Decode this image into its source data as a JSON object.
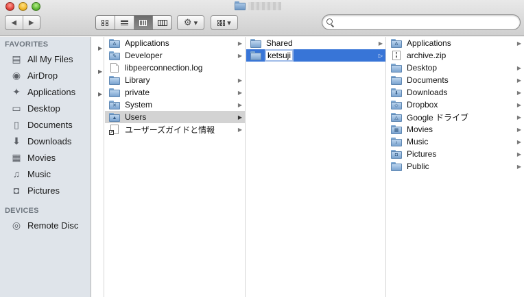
{
  "toolbar": {
    "back_glyph": "◀",
    "forward_glyph": "▶",
    "action_glyph": "⚙",
    "dropdown_glyph": "▾",
    "search_placeholder": ""
  },
  "sidebar": {
    "favorites_heading": "FAVORITES",
    "favorites": [
      {
        "label": "All My Files",
        "icon": "all-files-icon",
        "glyph": "▤"
      },
      {
        "label": "AirDrop",
        "icon": "airdrop-icon",
        "glyph": "◉"
      },
      {
        "label": "Applications",
        "icon": "applications-icon",
        "glyph": "✦"
      },
      {
        "label": "Desktop",
        "icon": "desktop-icon",
        "glyph": "▭"
      },
      {
        "label": "Documents",
        "icon": "documents-icon",
        "glyph": "▯"
      },
      {
        "label": "Downloads",
        "icon": "downloads-icon",
        "glyph": "⬇"
      },
      {
        "label": "Movies",
        "icon": "movies-icon",
        "glyph": "▦"
      },
      {
        "label": "Music",
        "icon": "music-icon",
        "glyph": "♫"
      },
      {
        "label": "Pictures",
        "icon": "pictures-icon",
        "glyph": "◘"
      }
    ],
    "devices_heading": "DEVICES",
    "devices": [
      {
        "label": "Remote Disc",
        "icon": "remote-disc-icon",
        "glyph": "◎"
      }
    ]
  },
  "column1": {
    "disclosures": [
      "▶",
      "▶",
      "▶"
    ]
  },
  "column2": {
    "items": [
      {
        "label": "Applications",
        "kind": "folder",
        "glyph": "A",
        "chev": "▶"
      },
      {
        "label": "Developer",
        "kind": "folder",
        "glyph": "✎",
        "chev": "▶"
      },
      {
        "label": "libpeerconnection.log",
        "kind": "doc",
        "glyph": "",
        "chev": ""
      },
      {
        "label": "Library",
        "kind": "folder",
        "glyph": "",
        "chev": "▶"
      },
      {
        "label": "private",
        "kind": "folder",
        "glyph": "",
        "chev": "▶"
      },
      {
        "label": "System",
        "kind": "folder",
        "glyph": "✕",
        "chev": "▶"
      },
      {
        "label": "Users",
        "kind": "folder",
        "glyph": "▲",
        "chev": "▶",
        "state": "grey"
      },
      {
        "label": "ユーザーズガイドと情報",
        "kind": "alias",
        "glyph": "",
        "chev": "▶"
      }
    ]
  },
  "column3": {
    "items": [
      {
        "label": "Shared",
        "kind": "folder",
        "glyph": "",
        "chev": "▶"
      },
      {
        "label": "ketsuji",
        "kind": "folder",
        "glyph": "",
        "chev": "▷",
        "state": "blue"
      }
    ]
  },
  "column4": {
    "items": [
      {
        "label": "Applications",
        "kind": "folder",
        "glyph": "A",
        "chev": "▶"
      },
      {
        "label": "archive.zip",
        "kind": "zip",
        "glyph": "",
        "chev": ""
      },
      {
        "label": "Desktop",
        "kind": "folder",
        "glyph": "",
        "chev": "▶"
      },
      {
        "label": "Documents",
        "kind": "folder",
        "glyph": "",
        "chev": "▶"
      },
      {
        "label": "Downloads",
        "kind": "folder",
        "glyph": "⬇",
        "chev": "▶"
      },
      {
        "label": "Dropbox",
        "kind": "folder",
        "glyph": "◇",
        "chev": "▶"
      },
      {
        "label": "Google ドライブ",
        "kind": "folder",
        "glyph": "△",
        "chev": "▶"
      },
      {
        "label": "Movies",
        "kind": "folder",
        "glyph": "▦",
        "chev": "▶"
      },
      {
        "label": "Music",
        "kind": "folder",
        "glyph": "♪",
        "chev": "▶"
      },
      {
        "label": "Pictures",
        "kind": "folder",
        "glyph": "◘",
        "chev": "▶"
      },
      {
        "label": "Public",
        "kind": "folder",
        "glyph": "",
        "chev": "▶"
      }
    ]
  }
}
